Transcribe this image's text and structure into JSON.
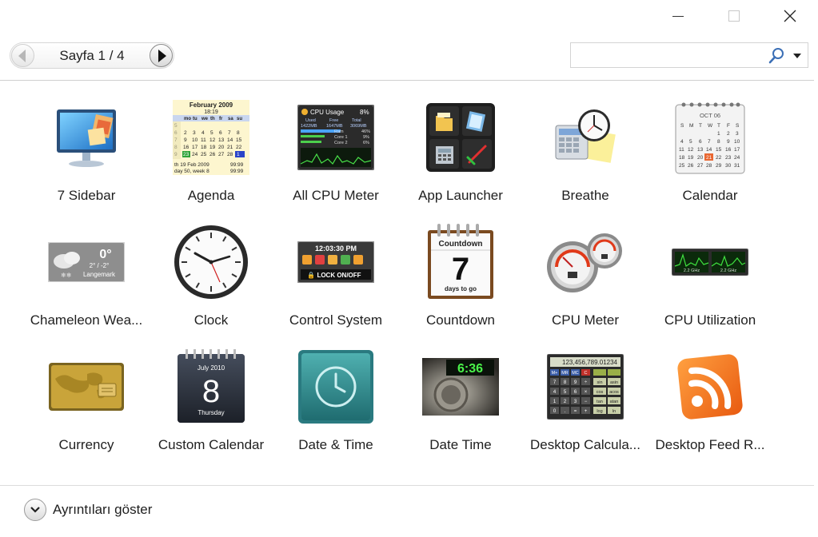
{
  "window": {
    "controls": {
      "minimize": "minimize",
      "maximize": "maximize",
      "close": "close"
    }
  },
  "pager": {
    "label": "Sayfa 1 / 4"
  },
  "search": {
    "value": "",
    "placeholder": ""
  },
  "gadgets": [
    {
      "name": "7 Sidebar"
    },
    {
      "name": "Agenda"
    },
    {
      "name": "All CPU Meter"
    },
    {
      "name": "App Launcher"
    },
    {
      "name": "Breathe"
    },
    {
      "name": "Calendar"
    },
    {
      "name": "Chameleon Wea..."
    },
    {
      "name": "Clock"
    },
    {
      "name": "Control System"
    },
    {
      "name": "Countdown"
    },
    {
      "name": "CPU Meter"
    },
    {
      "name": "CPU Utilization"
    },
    {
      "name": "Currency"
    },
    {
      "name": "Custom Calendar"
    },
    {
      "name": "Date & Time"
    },
    {
      "name": "Date Time"
    },
    {
      "name": "Desktop Calcula..."
    },
    {
      "name": "Desktop Feed R..."
    }
  ],
  "icon_text": {
    "agenda_month": "February 2009",
    "agenda_time": "18:19",
    "agenda_days": [
      "mo",
      "tu",
      "we",
      "th",
      "fr",
      "sa",
      "su"
    ],
    "agenda_footer1": "th 19 Feb 2009",
    "agenda_footer2": "day 50, week 8",
    "cpu_title": "CPU Usage",
    "cpu_pct": "8%",
    "cpu_used": "Used",
    "cpu_free": "Free",
    "cpu_total": "Total",
    "cpu_used_val": "1422MB",
    "cpu_free_val": "1647MB",
    "cpu_total_val": "3069MB",
    "cpu_ram": "Ram",
    "cpu_ram_pct": "46%",
    "cpu_core1": "Core 1",
    "cpu_core1_pct": "9%",
    "cpu_core2": "Core 2",
    "cpu_core2_pct": "6%",
    "calendar_month": "OCT 06",
    "weather_temp": "0°",
    "weather_range": "2° / -2°",
    "weather_city": "Langemark",
    "control_time": "12:03:30 PM",
    "control_lock": "LOCK ON/OFF",
    "countdown_title": "Countdown",
    "countdown_num": "7",
    "countdown_sub": "days to go",
    "cpuutil_left": "2.2 GHz",
    "cpuutil_right": "2.2 GHz",
    "custom_month": "July 2010",
    "custom_num": "8",
    "custom_day": "Thursday",
    "datetime_display": "6:36",
    "calc_display": "123,456,789.01234"
  },
  "footer": {
    "details_label": "Ayrıntıları göster"
  },
  "colors": {
    "divider": "#cfcfcf",
    "text": "#1f1f1f",
    "feed_orange": "#f47b20"
  }
}
